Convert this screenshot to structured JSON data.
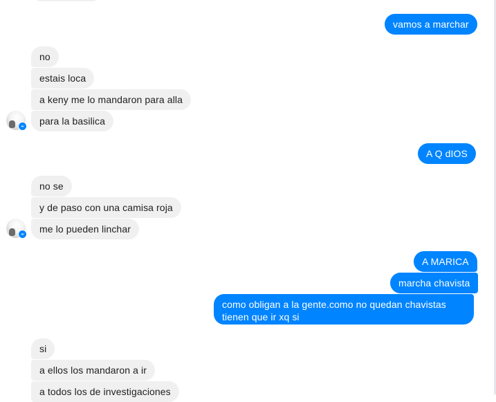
{
  "messages": {
    "m1": "vamos a marchar",
    "m2": "no",
    "m3": "estais loca",
    "m4": "a keny me lo mandaron para alla",
    "m5": "para la basilica",
    "m6": "A Q dIOS",
    "m7": "no se",
    "m8": "y de paso con una camisa roja",
    "m9": "me lo pueden linchar",
    "m10": "A MARICA",
    "m11": "marcha chavista",
    "m12_line1": "como obligan a la gente.como no quedan chavistas",
    "m12_line2": "tienen que ir xq si",
    "m13": "si",
    "m14": "a ellos los mandaron a ir",
    "m15": "a todos los de investigaciones"
  },
  "colors": {
    "outgoing_bubble": "#0084ff",
    "incoming_bubble": "#f1f0f0",
    "incoming_text": "#1c1e21",
    "messenger_badge": "#0084ff"
  },
  "icons": {
    "avatar": "contact-avatar-icon",
    "badge": "messenger-badge-icon"
  }
}
